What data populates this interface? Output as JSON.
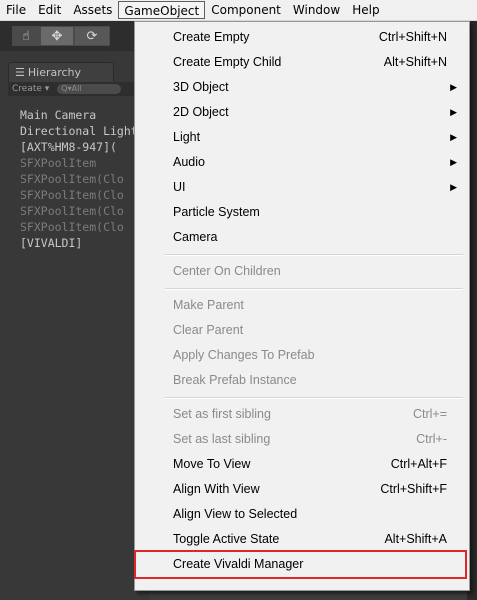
{
  "menubar": [
    {
      "label": "File",
      "active": false
    },
    {
      "label": "Edit",
      "active": false
    },
    {
      "label": "Assets",
      "active": false
    },
    {
      "label": "GameObject",
      "active": true
    },
    {
      "label": "Component",
      "active": false
    },
    {
      "label": "Window",
      "active": false
    },
    {
      "label": "Help",
      "active": false
    }
  ],
  "toolbar": {
    "hand_icon": "hand-icon",
    "move_icon": "move-arrows-icon",
    "rotate_icon": "rotate-icon"
  },
  "hierarchy": {
    "tab_label": "Hierarchy",
    "create_label": "Create ▾",
    "search_placeholder": "Q▾All",
    "items": [
      {
        "label": "Main Camera",
        "dim": false
      },
      {
        "label": "Directional Light",
        "dim": false
      },
      {
        "label": "[AXT%HM8-947](",
        "dim": false
      },
      {
        "label": "SFXPoolItem",
        "dim": true
      },
      {
        "label": "SFXPoolItem(Clo",
        "dim": true
      },
      {
        "label": "SFXPoolItem(Clo",
        "dim": true
      },
      {
        "label": "SFXPoolItem(Clo",
        "dim": true
      },
      {
        "label": "SFXPoolItem(Clo",
        "dim": true
      },
      {
        "label": "[VIVALDI]",
        "dim": false
      }
    ]
  },
  "dropdown": {
    "items": [
      {
        "label": "Create Empty",
        "shortcut": "Ctrl+Shift+N"
      },
      {
        "label": "Create Empty Child",
        "shortcut": "Alt+Shift+N"
      },
      {
        "label": "3D Object",
        "submenu": true
      },
      {
        "label": "2D Object",
        "submenu": true
      },
      {
        "label": "Light",
        "submenu": true
      },
      {
        "label": "Audio",
        "submenu": true
      },
      {
        "label": "UI",
        "submenu": true
      },
      {
        "label": "Particle System"
      },
      {
        "label": "Camera"
      },
      {
        "separator": true
      },
      {
        "label": "Center On Children",
        "disabled": true
      },
      {
        "separator": true
      },
      {
        "label": "Make Parent",
        "disabled": true
      },
      {
        "label": "Clear Parent",
        "disabled": true
      },
      {
        "label": "Apply Changes To Prefab",
        "disabled": true
      },
      {
        "label": "Break Prefab Instance",
        "disabled": true
      },
      {
        "separator": true
      },
      {
        "label": "Set as first sibling",
        "shortcut": "Ctrl+=",
        "disabled": true
      },
      {
        "label": "Set as last sibling",
        "shortcut": "Ctrl+-",
        "disabled": true
      },
      {
        "label": "Move To View",
        "shortcut": "Ctrl+Alt+F"
      },
      {
        "label": "Align With View",
        "shortcut": "Ctrl+Shift+F"
      },
      {
        "label": "Align View to Selected"
      },
      {
        "label": "Toggle Active State",
        "shortcut": "Alt+Shift+A"
      },
      {
        "label": "Create Vivaldi Manager",
        "highlighted": true
      }
    ]
  },
  "colors": {
    "highlight_border": "#e0262d",
    "editor_bg": "#383838",
    "menu_bg": "#f1f1f1"
  }
}
